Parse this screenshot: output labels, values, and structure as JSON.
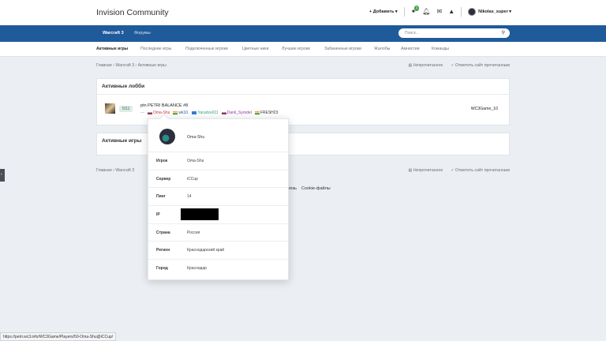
{
  "header": {
    "site_title": "Invision Community",
    "add_label": "+ Добавить ▾",
    "notif_count": "1",
    "username": "Nikolas_super ▾"
  },
  "navbar": {
    "items": [
      "Warcraft 3",
      "Форумы"
    ],
    "search_placeholder": "Поиск..."
  },
  "subnav": {
    "items": [
      "Активные игры",
      "Последние игры",
      "Подключенные игроки",
      "Цветные ники",
      "Лучшие игроки",
      "Забаненные игроки",
      "Жалобы",
      "Амнистии",
      "Команды"
    ]
  },
  "breadcrumb": {
    "items": [
      "Главная",
      "Warcraft 3",
      "Активные игры"
    ],
    "unread": "Непрочитанное",
    "mark_read": "Отметить сайт прочитанным"
  },
  "lobbies": {
    "title": "Активные лобби",
    "row": {
      "count": "5/11",
      "name": "ptn PETRI BALANCE #8",
      "host": "WC3Game_10",
      "players": [
        {
          "name": "Oma-Shu",
          "color": "#d0343a"
        },
        {
          "name": "wk10.",
          "color": "#1f5b9a"
        },
        {
          "name": "Yarudze011",
          "color": "#35a07a"
        },
        {
          "name": "Danil_Syrodel",
          "color": "#8a3aa8"
        },
        {
          "name": "FRESH23",
          "color": "#333333"
        }
      ]
    }
  },
  "games": {
    "title": "Активные игры"
  },
  "breadcrumb2": {
    "items": [
      "Главная",
      "Warcraft 3"
    ]
  },
  "footer": {
    "links": [
      "связь",
      "Cookie-файлы"
    ]
  },
  "popup": {
    "name": "Oma-Shu",
    "rows": [
      {
        "label": "Игрок",
        "value": "Oma-Shu"
      },
      {
        "label": "Сервер",
        "value": "iCCup"
      },
      {
        "label": "Пинг",
        "value": "14"
      },
      {
        "label": "IP",
        "value": ""
      },
      {
        "label": "Страна",
        "value": "Россия"
      },
      {
        "label": "Регион",
        "value": "Краснодарский край"
      },
      {
        "label": "Город",
        "value": "Краснодар"
      }
    ]
  },
  "status_url": "https://petri.wc3.info/WC3Game/Players/50-Oma-Shu@iCCup/"
}
